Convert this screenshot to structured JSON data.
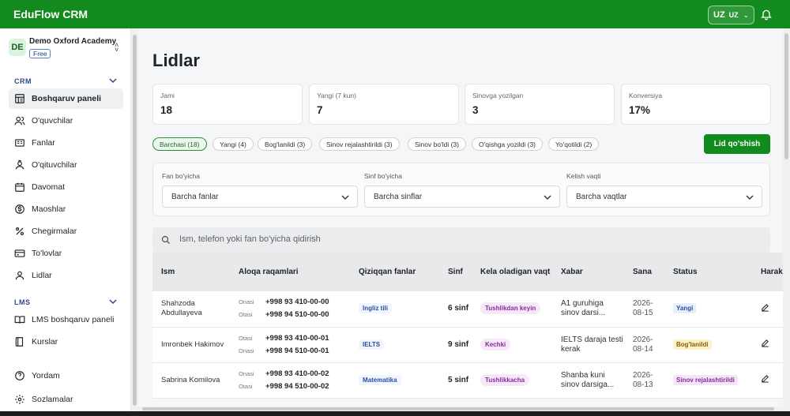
{
  "app": {
    "brand": "EduFlow CRM"
  },
  "header": {
    "language_code": "UZ",
    "language_label": "UZ"
  },
  "colors": {
    "brand_green": "#138a1e",
    "nav_section": "#2e4a8a"
  },
  "sidebar": {
    "org_initials": "DE",
    "org_name": "Demo Oxford Academy",
    "plan": "Free",
    "crm_section": "CRM",
    "crm_items": [
      {
        "label": "Boshqaruv paneli",
        "icon": "dashboard-icon",
        "active": true
      },
      {
        "label": "O'quvchilar",
        "icon": "users-icon"
      },
      {
        "label": "Fanlar",
        "icon": "book-icon"
      },
      {
        "label": "O'qituvchilar",
        "icon": "teacher-icon"
      },
      {
        "label": "Davomat",
        "icon": "calendar-icon"
      },
      {
        "label": "Maoshlar",
        "icon": "dollar-icon"
      },
      {
        "label": "Chegirmalar",
        "icon": "percent-icon"
      },
      {
        "label": "To'lovlar",
        "icon": "payment-icon"
      },
      {
        "label": "Lidlar",
        "icon": "person-icon"
      }
    ],
    "lms_section": "LMS",
    "lms_items": [
      {
        "label": "LMS boshqaruv paneli",
        "icon": "book-open-icon"
      },
      {
        "label": "Kurslar",
        "icon": "notebook-icon"
      }
    ],
    "footer_items": [
      {
        "label": "Yordam",
        "icon": "help-icon"
      },
      {
        "label": "Sozlamalar",
        "icon": "settings-icon"
      }
    ]
  },
  "page": {
    "title": "Lidlar"
  },
  "stats": [
    {
      "label": "Jami",
      "value": "18"
    },
    {
      "label": "Yangi (7 kun)",
      "value": "7"
    },
    {
      "label": "Sinovga yozilgan",
      "value": "3"
    },
    {
      "label": "Konversiya",
      "value": "17%"
    }
  ],
  "filter_chips": [
    "Barchasi (18)",
    "Yangi (4)",
    "Bog'lanildi (3)",
    "Sinov rejalashtirildi (3)",
    "Sinov bo'ldi (3)",
    "O'qishga yozildi (3)",
    "Yo'qotildi (2)"
  ],
  "add_button": "Lid qo'shish",
  "filters": [
    {
      "label": "Fan bo'yicha",
      "value": "Barcha fanlar"
    },
    {
      "label": "Sinf bo'yicha",
      "value": "Barcha sinflar"
    },
    {
      "label": "Kelish vaqti",
      "value": "Barcha vaqtlar"
    }
  ],
  "search": {
    "placeholder": "Ism, telefon yoki fan bo'yicha qidirish"
  },
  "table": {
    "columns": [
      "Ism",
      "Aloqa raqamlari",
      "Qiziqqan fanlar",
      "Sinf",
      "Kela oladigan vaqt",
      "Xabar",
      "Sana",
      "Status",
      "Harakatlar"
    ],
    "rows": [
      {
        "name": "Shahzoda Abdullayeva",
        "contact1_label": "Onasi",
        "contact1": "+998 93 410-00-00",
        "contact2_label": "Otasi",
        "contact2": "+998 94 510-00-00",
        "subject": "Ingliz tili",
        "grade": "6 sinf",
        "time": "Tushlikdan keyin",
        "message": "A1 guruhiga sinov darsi...",
        "date": "2026-08-15",
        "status": "Yangi",
        "status_bg": "#e6eefb",
        "status_fg": "#2451a8"
      },
      {
        "name": "Imronbek Hakimov",
        "contact1_label": "Otasi",
        "contact1": "+998 93 410-00-01",
        "contact2_label": "Onasi",
        "contact2": "+998 94 510-00-01",
        "subject": "IELTS",
        "grade": "9 sinf",
        "time": "Kechki",
        "message": "IELTS daraja testi kerak",
        "date": "2026-08-14",
        "status": "Bog'lanildi",
        "status_bg": "#fdf3c9",
        "status_fg": "#8a5a00"
      },
      {
        "name": "Sabrina Komilova",
        "contact1_label": "Onasi",
        "contact1": "+998 93 410-00-02",
        "contact2_label": "Otasi",
        "contact2": "+998 94 510-00-02",
        "subject": "Matematika",
        "grade": "5 sinf",
        "time": "Tushlikkacha",
        "message": "Shanba kuni sinov darsiga...",
        "date": "2026-08-13",
        "status": "Sinov rejalashtirildi",
        "status_bg": "#f3e6f7",
        "status_fg": "#8a2a9e"
      }
    ]
  }
}
